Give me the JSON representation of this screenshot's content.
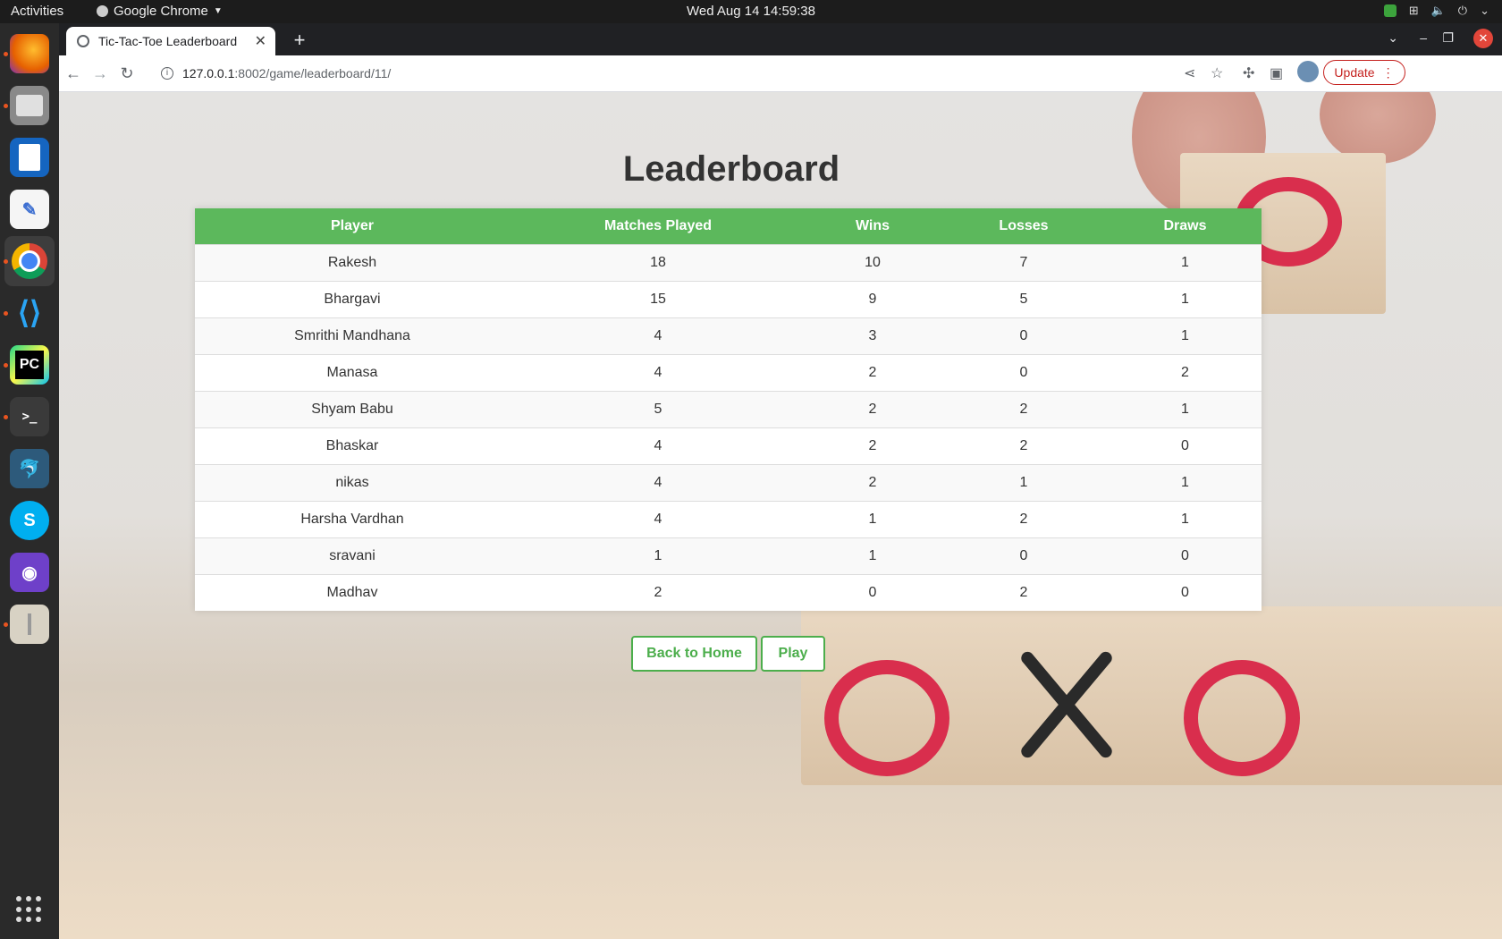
{
  "system_bar": {
    "activities": "Activities",
    "app_name": "Google Chrome",
    "clock": "Wed Aug 14  14:59:38"
  },
  "dock": {
    "apps": [
      "firefox-icon",
      "files-icon",
      "writer-icon",
      "text-editor-icon",
      "chrome-icon",
      "vscode-icon",
      "pycharm-icon",
      "terminal-icon",
      "mysql-workbench-icon",
      "skype-icon",
      "github-desktop-icon",
      "archive-icon"
    ],
    "active_app": "chrome-icon"
  },
  "browser": {
    "tab_title": "Tic-Tac-Toe Leaderboard",
    "url_host": "127.0.0.1",
    "url_path": ":8002/game/leaderboard/11/",
    "update_label": "Update"
  },
  "page": {
    "title": "Leaderboard",
    "columns": [
      "Player",
      "Matches Played",
      "Wins",
      "Losses",
      "Draws"
    ],
    "rows": [
      [
        "Rakesh",
        "18",
        "10",
        "7",
        "1"
      ],
      [
        "Bhargavi",
        "15",
        "9",
        "5",
        "1"
      ],
      [
        "Smrithi Mandhana",
        "4",
        "3",
        "0",
        "1"
      ],
      [
        "Manasa",
        "4",
        "2",
        "0",
        "2"
      ],
      [
        "Shyam Babu",
        "5",
        "2",
        "2",
        "1"
      ],
      [
        "Bhaskar",
        "4",
        "2",
        "2",
        "0"
      ],
      [
        "nikas",
        "4",
        "2",
        "1",
        "1"
      ],
      [
        "Harsha Vardhan",
        "4",
        "1",
        "2",
        "1"
      ],
      [
        "sravani",
        "1",
        "1",
        "0",
        "0"
      ],
      [
        "Madhav",
        "2",
        "0",
        "2",
        "0"
      ]
    ],
    "back_button": "Back to Home",
    "play_button": "Play"
  },
  "colors": {
    "header_green": "#5cb85c",
    "button_green": "#4cae4c"
  }
}
